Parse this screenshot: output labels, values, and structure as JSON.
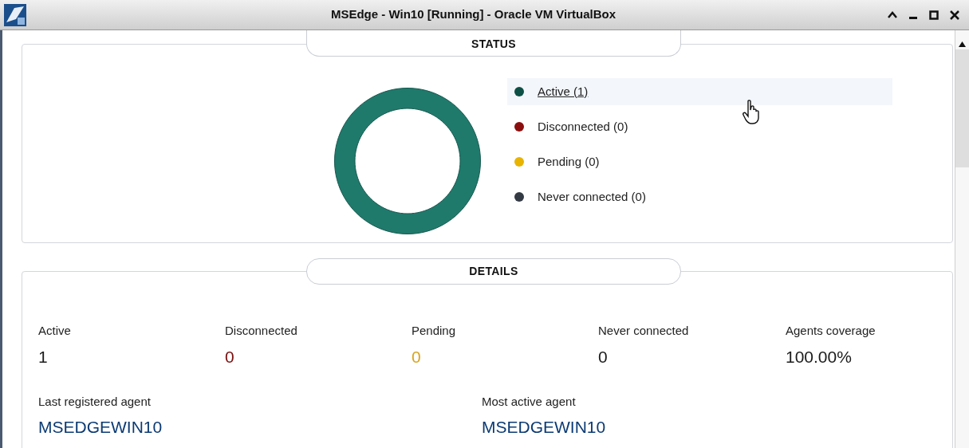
{
  "window": {
    "title": "MSEdge - Win10 [Running] - Oracle VM VirtualBox"
  },
  "status": {
    "title": "STATUS",
    "legend": [
      {
        "label": "Active (1)",
        "color": "#0d4f45",
        "selected": true
      },
      {
        "label": "Disconnected (0)",
        "color": "#8b0e0e",
        "selected": false
      },
      {
        "label": "Pending (0)",
        "color": "#e8b400",
        "selected": false
      },
      {
        "label": "Never connected (0)",
        "color": "#333a44",
        "selected": false
      }
    ]
  },
  "details": {
    "title": "DETAILS",
    "stats": [
      {
        "label": "Active",
        "value": "1",
        "color": "#1b1b1b"
      },
      {
        "label": "Disconnected",
        "value": "0",
        "color": "#7a1010"
      },
      {
        "label": "Pending",
        "value": "0",
        "color": "#d9a520"
      },
      {
        "label": "Never connected",
        "value": "0",
        "color": "#1b1b1b"
      },
      {
        "label": "Agents coverage",
        "value": "100.00%",
        "color": "#1b1b1b"
      }
    ],
    "agents": [
      {
        "label": "Last registered agent",
        "value": "MSEDGEWIN10"
      },
      {
        "label": "Most active agent",
        "value": "MSEDGEWIN10"
      }
    ]
  }
}
